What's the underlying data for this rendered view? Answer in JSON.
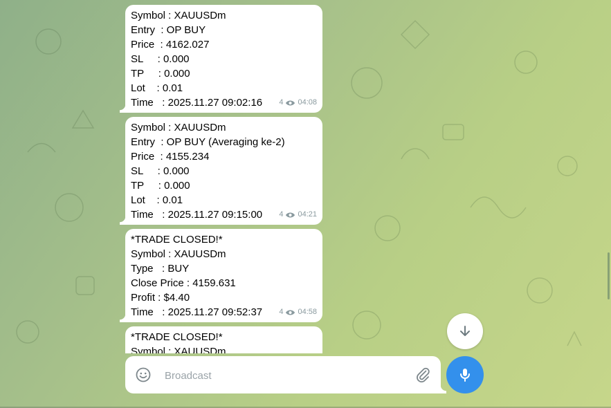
{
  "messages": [
    {
      "lines": [
        "Symbol : XAUUSDm",
        "Entry  : OP BUY",
        "Price  : 4162.027",
        "SL     : 0.000",
        "TP     : 0.000",
        "Lot    : 0.01",
        "Time   : 2025.11.27 09:02:16"
      ],
      "views": "4",
      "time": "04:08"
    },
    {
      "lines": [
        "Symbol : XAUUSDm",
        "Entry  : OP BUY (Averaging ke-2)",
        "Price  : 4155.234",
        "SL     : 0.000",
        "TP     : 0.000",
        "Lot    : 0.01",
        "Time   : 2025.11.27 09:15:00"
      ],
      "views": "4",
      "time": "04:21"
    },
    {
      "lines": [
        "*TRADE CLOSED!*",
        "Symbol : XAUUSDm",
        "Type   : BUY",
        "Close Price : 4159.631",
        "Profit : $4.40",
        "Time   : 2025.11.27 09:52:37"
      ],
      "views": "4",
      "time": "04:58"
    },
    {
      "lines": [
        "*TRADE CLOSED!*",
        "Symbol : XAUUSDm"
      ],
      "views": "",
      "time": ""
    }
  ],
  "composer": {
    "placeholder": "Broadcast"
  },
  "icons": {
    "emoji": "smile-icon",
    "attach": "paperclip-icon",
    "mic": "microphone-icon",
    "scroll_down": "arrow-down-icon",
    "views": "eye-icon"
  },
  "colors": {
    "accent": "#3390ec",
    "bubble": "#ffffff",
    "meta": "#8a9a9f"
  }
}
